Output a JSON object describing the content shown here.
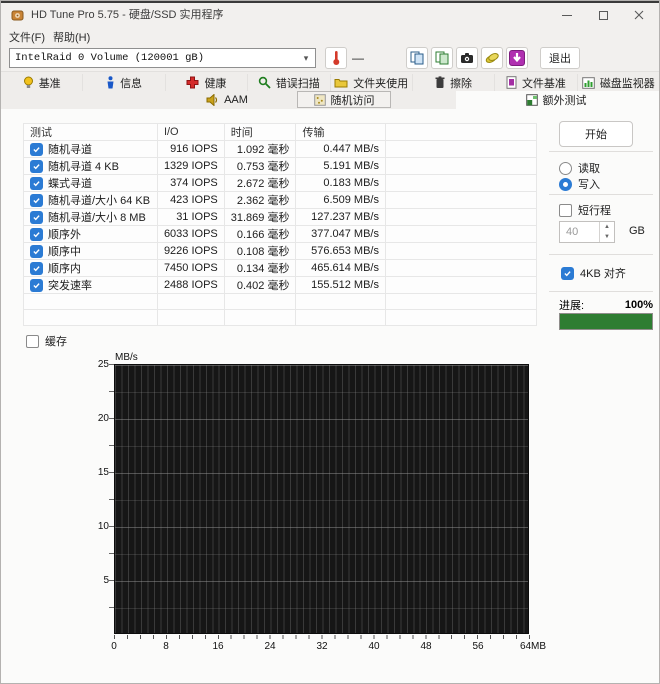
{
  "window": {
    "title": "HD Tune Pro 5.75 - 硬盘/SSD 实用程序"
  },
  "menu": {
    "items": [
      {
        "label": "文件(F)"
      },
      {
        "label": "帮助(H)"
      }
    ]
  },
  "toolbar": {
    "device_dropdown_value": "IntelRaid 0 Volume (120001 gB)",
    "temperature_value": "—",
    "exit_label": "退出"
  },
  "tabs": {
    "row1": [
      {
        "label": "基准"
      },
      {
        "label": "信息"
      },
      {
        "label": "健康"
      },
      {
        "label": "错误扫描"
      },
      {
        "label": "文件夹使用"
      },
      {
        "label": "擦除"
      },
      {
        "label": "文件基准"
      },
      {
        "label": "磁盘监视器"
      }
    ],
    "row2": [
      {
        "label": "AAM"
      },
      {
        "label": "随机访问"
      },
      {
        "label": "额外测试"
      }
    ]
  },
  "table": {
    "headers": {
      "test": "测试",
      "io": "I/O",
      "time": "时间",
      "transfer": "传输"
    },
    "rows": [
      {
        "name": "随机寻道",
        "io": "916 IOPS",
        "time": "1.092 毫秒",
        "transfer": "0.447 MB/s"
      },
      {
        "name": "随机寻道 4 KB",
        "io": "1329 IOPS",
        "time": "0.753 毫秒",
        "transfer": "5.191 MB/s"
      },
      {
        "name": "蝶式寻道",
        "io": "374 IOPS",
        "time": "2.672 毫秒",
        "transfer": "0.183 MB/s"
      },
      {
        "name": "随机寻道/大小 64 KB",
        "io": "423 IOPS",
        "time": "2.362 毫秒",
        "transfer": "6.509 MB/s"
      },
      {
        "name": "随机寻道/大小 8 MB",
        "io": "31 IOPS",
        "time": "31.869 毫秒",
        "transfer": "127.237 MB/s"
      },
      {
        "name": "顺序外",
        "io": "6033 IOPS",
        "time": "0.166 毫秒",
        "transfer": "377.047 MB/s"
      },
      {
        "name": "顺序中",
        "io": "9226 IOPS",
        "time": "0.108 毫秒",
        "transfer": "576.653 MB/s"
      },
      {
        "name": "顺序内",
        "io": "7450 IOPS",
        "time": "0.134 毫秒",
        "transfer": "465.614 MB/s"
      },
      {
        "name": "突发速率",
        "io": "2488 IOPS",
        "time": "0.402 毫秒",
        "transfer": "155.512 MB/s"
      }
    ]
  },
  "panel": {
    "start_label": "开始",
    "read_label": "读取",
    "write_label": "写入",
    "short_stroke_label": "短行程",
    "capacity_value": "40",
    "capacity_unit": "GB",
    "align_label": "4KB 对齐",
    "progress_label": "进展:",
    "progress_percent": "100%"
  },
  "cache_label": "缓存",
  "colors": {
    "accent_blue": "#2b7bd4",
    "progress_green": "#2e7d32",
    "plot_background": "#161616"
  },
  "chart_data": {
    "type": "line",
    "title": "",
    "ylabel": "MB/s",
    "xlabel": "",
    "ylim": [
      0,
      25
    ],
    "xlim_mb": [
      0,
      64
    ],
    "y_ticks": [
      "25",
      "20",
      "15",
      "10",
      "5"
    ],
    "x_ticks": [
      "0",
      "8",
      "16",
      "24",
      "32",
      "40",
      "48",
      "56",
      "64MB"
    ],
    "grid": true,
    "legend": "none",
    "series": []
  }
}
